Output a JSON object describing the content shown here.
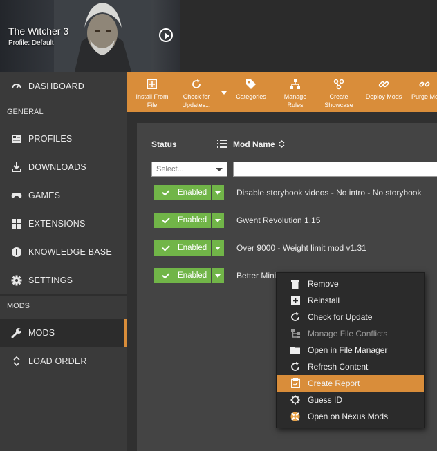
{
  "game": {
    "title": "The Witcher 3",
    "profile": "Profile: Default"
  },
  "sidebar": {
    "dashboard": "DASHBOARD",
    "general_header": "GENERAL",
    "general_items": [
      "PROFILES",
      "DOWNLOADS",
      "GAMES",
      "EXTENSIONS",
      "KNOWLEDGE BASE",
      "SETTINGS"
    ],
    "mods_header": "MODS",
    "mods_items": [
      "MODS",
      "LOAD ORDER"
    ]
  },
  "toolbar": {
    "install_from_file": [
      "Install From",
      "File"
    ],
    "check_for_updates": [
      "Check for",
      "Updates..."
    ],
    "categories": "Categories",
    "manage_rules": [
      "Manage",
      "Rules"
    ],
    "create_showcase": [
      "Create",
      "Showcase"
    ],
    "deploy_mods": "Deploy Mods",
    "purge_mods": "Purge Mo"
  },
  "table": {
    "status_header": "Status",
    "name_header": "Mod Name",
    "status_placeholder": "Select...",
    "rows": [
      {
        "status": "Enabled",
        "name": "Disable storybook videos - No intro - No storybook"
      },
      {
        "status": "Enabled",
        "name": "Gwent Revolution 1.15"
      },
      {
        "status": "Enabled",
        "name": "Over 9000 - Weight limit mod v1.31"
      },
      {
        "status": "Enabled",
        "name": "Better Minimap for v1.22"
      }
    ]
  },
  "context_menu": {
    "items": [
      {
        "label": "Remove",
        "icon": "trash-icon"
      },
      {
        "label": "Reinstall",
        "icon": "plus-box-icon"
      },
      {
        "label": "Check for Update",
        "icon": "refresh-icon"
      },
      {
        "label": "Manage File Conflicts",
        "icon": "conflict-icon",
        "disabled": true
      },
      {
        "label": "Open in File Manager",
        "icon": "folder-icon"
      },
      {
        "label": "Refresh Content",
        "icon": "refresh-icon"
      },
      {
        "label": "Create Report",
        "icon": "report-icon",
        "highlighted": true
      },
      {
        "label": "Guess ID",
        "icon": "gear-icon"
      },
      {
        "label": "Open on Nexus Mods",
        "icon": "nexus-icon"
      }
    ]
  },
  "colors": {
    "accent": "#d98d3a",
    "enabled": "#71b548",
    "sidebar": "#3a3a3a",
    "background": "#2b2b2b"
  }
}
